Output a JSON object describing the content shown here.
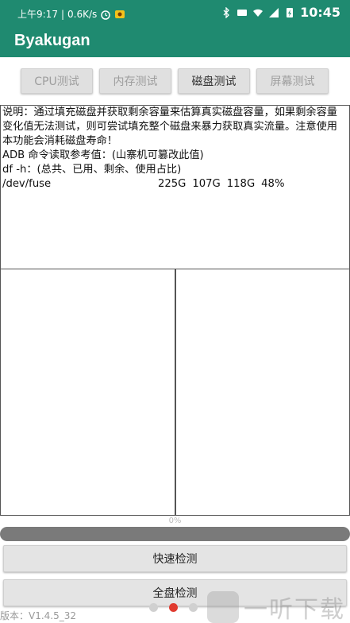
{
  "statusbar": {
    "time_left": "上午9:17",
    "speed": "0.6K/s",
    "time_right": "10:45"
  },
  "app": {
    "title": "Byakugan"
  },
  "tabs": [
    {
      "label": "CPU测试",
      "active": false
    },
    {
      "label": "内存测试",
      "active": false
    },
    {
      "label": "磁盘测试",
      "active": true
    },
    {
      "label": "屏幕测试",
      "active": false
    }
  ],
  "description": {
    "line1": "说明：通过填充磁盘并获取剩余容量来估算真实磁盘容量，如果剩余容量变化值无法测试，则可尝试填充整个磁盘来暴力获取真实流量。注意使用本功能会消耗磁盘寿命！",
    "line2": "ADB 命令读取参考值：(山寨机可篡改此值)",
    "line3": "df -h：(总共、已用、剩余、使用占比)",
    "fuse": {
      "path": "/dev/fuse",
      "total": "225G",
      "used": "107G",
      "free": "118G",
      "percent": "48%"
    }
  },
  "progress": {
    "label": "0%",
    "value": 0
  },
  "buttons": {
    "quick": "快速检测",
    "full": "全盘检测"
  },
  "version": "版本：V1.4.5_32",
  "watermark": "一听下载",
  "colors": {
    "primary": "#1f8a70",
    "indicator_active": "#e03a2f"
  }
}
